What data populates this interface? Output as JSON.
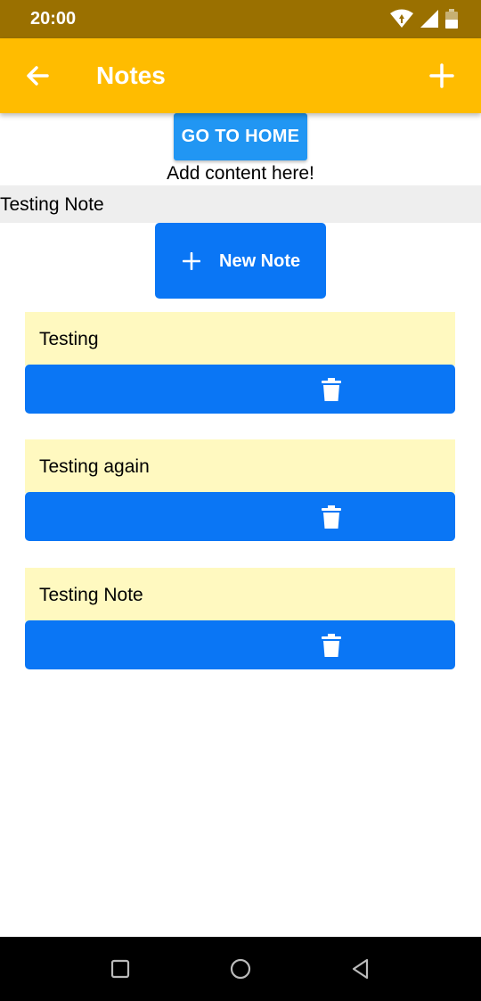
{
  "status_bar": {
    "time": "20:00",
    "icons": [
      "wifi-icon",
      "signal-icon",
      "battery-icon"
    ]
  },
  "app_bar": {
    "title": "Notes",
    "left_icon": "arrow-back-icon",
    "right_icon": "add-icon"
  },
  "home_button_label": "GO TO HOME",
  "content_hint": "Add content here!",
  "banner_text": "Testing Note",
  "new_note_button": {
    "label": "New Note",
    "icon": "plus-icon"
  },
  "notes": [
    {
      "text": "Testing",
      "action_icon": "trash-icon"
    },
    {
      "text": "Testing again",
      "action_icon": "trash-icon"
    },
    {
      "text": "Testing Note",
      "action_icon": "trash-icon"
    }
  ],
  "nav_bar": {
    "buttons": [
      "recent-apps-icon",
      "home-icon",
      "back-icon"
    ]
  },
  "colors": {
    "status_bar": "#9a7000",
    "app_bar": "#ffbc00",
    "primary_button": "#0a76f5",
    "home_button": "#2196f3",
    "note_background": "#fff9c0",
    "banner_background": "#eeeeee"
  }
}
